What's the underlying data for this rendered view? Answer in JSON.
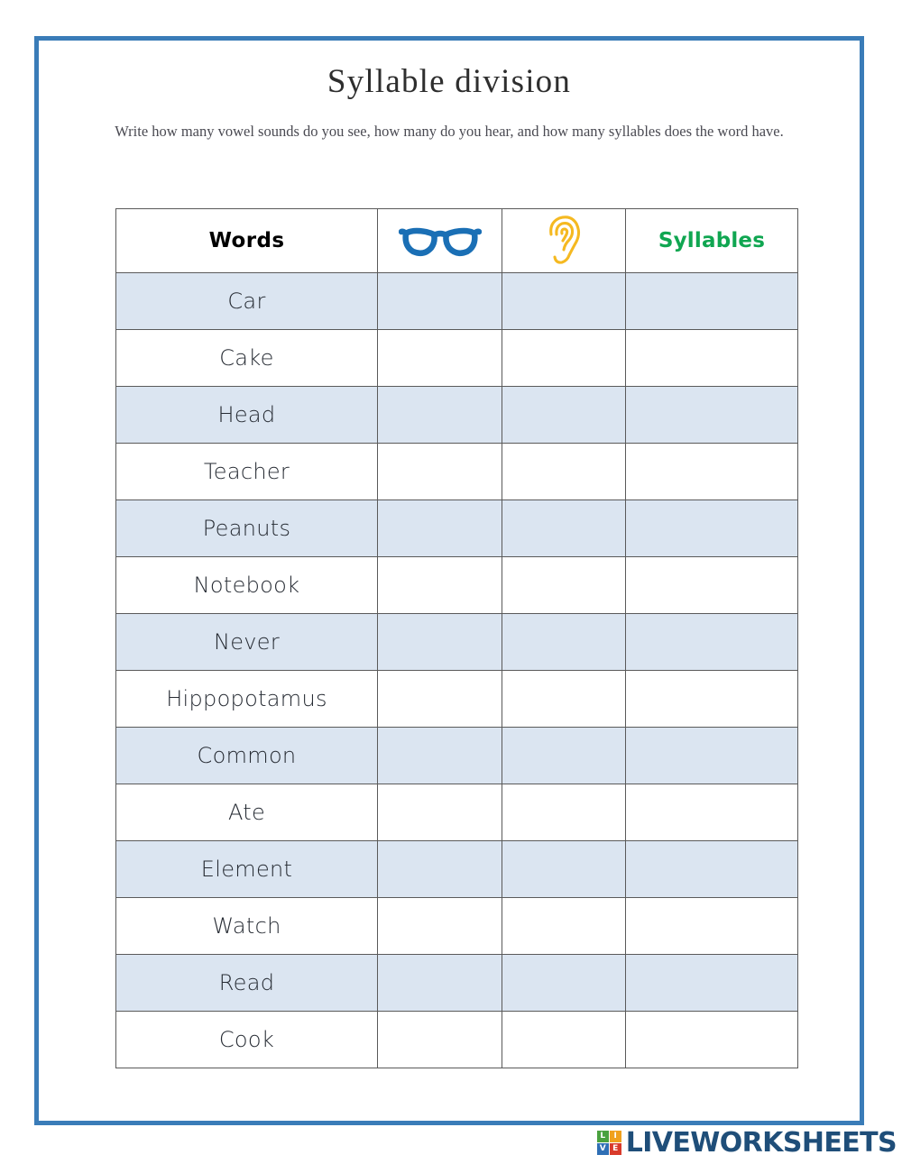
{
  "page": {
    "title": "Syllable division",
    "subtitle": "Write how many vowel sounds do you see, how many do you hear, and how many syllables does the word have.",
    "frame_color": "#3a7cb8"
  },
  "table": {
    "headers": {
      "words": "Words",
      "see_icon": "glasses-icon",
      "hear_icon": "ear-icon",
      "syllables": "Syllables"
    },
    "colors": {
      "words_label": "#000000",
      "syllables_label": "#10a651",
      "glasses": "#1a6fb5",
      "ear": "#f5b921",
      "row_shaded": "#dbe5f1",
      "row_plain": "#ffffff",
      "border": "#5a5a5a"
    },
    "rows": [
      {
        "word": "Car",
        "see": "",
        "hear": "",
        "syllables": ""
      },
      {
        "word": "Cake",
        "see": "",
        "hear": "",
        "syllables": ""
      },
      {
        "word": "Head",
        "see": "",
        "hear": "",
        "syllables": ""
      },
      {
        "word": "Teacher",
        "see": "",
        "hear": "",
        "syllables": ""
      },
      {
        "word": "Peanuts",
        "see": "",
        "hear": "",
        "syllables": ""
      },
      {
        "word": "Notebook",
        "see": "",
        "hear": "",
        "syllables": ""
      },
      {
        "word": "Never",
        "see": "",
        "hear": "",
        "syllables": ""
      },
      {
        "word": "Hippopotamus",
        "see": "",
        "hear": "",
        "syllables": ""
      },
      {
        "word": "Common",
        "see": "",
        "hear": "",
        "syllables": ""
      },
      {
        "word": "Ate",
        "see": "",
        "hear": "",
        "syllables": ""
      },
      {
        "word": "Element",
        "see": "",
        "hear": "",
        "syllables": ""
      },
      {
        "word": "Watch",
        "see": "",
        "hear": "",
        "syllables": ""
      },
      {
        "word": "Read",
        "see": "",
        "hear": "",
        "syllables": ""
      },
      {
        "word": "Cook",
        "see": "",
        "hear": "",
        "syllables": ""
      }
    ]
  },
  "footer": {
    "logo": {
      "badge_letters": [
        "L",
        "I",
        "V",
        "E"
      ],
      "wordmark": "LIVEWORKSHEETS",
      "wordmark_color": "#1f4e79"
    }
  }
}
